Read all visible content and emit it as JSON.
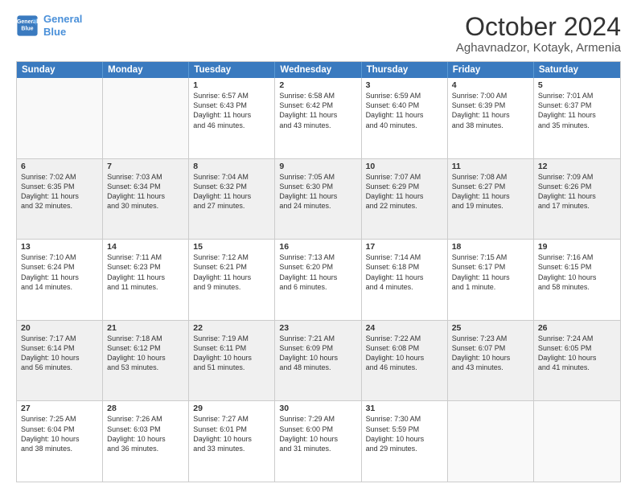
{
  "header": {
    "logo_line1": "General",
    "logo_line2": "Blue",
    "title": "October 2024",
    "subtitle": "Aghavnadzor, Kotayk, Armenia"
  },
  "calendar": {
    "days_of_week": [
      "Sunday",
      "Monday",
      "Tuesday",
      "Wednesday",
      "Thursday",
      "Friday",
      "Saturday"
    ],
    "weeks": [
      [
        {
          "day": "",
          "detail": "",
          "empty": true
        },
        {
          "day": "",
          "detail": "",
          "empty": true
        },
        {
          "day": "1",
          "detail": "Sunrise: 6:57 AM\nSunset: 6:43 PM\nDaylight: 11 hours\nand 46 minutes."
        },
        {
          "day": "2",
          "detail": "Sunrise: 6:58 AM\nSunset: 6:42 PM\nDaylight: 11 hours\nand 43 minutes."
        },
        {
          "day": "3",
          "detail": "Sunrise: 6:59 AM\nSunset: 6:40 PM\nDaylight: 11 hours\nand 40 minutes."
        },
        {
          "day": "4",
          "detail": "Sunrise: 7:00 AM\nSunset: 6:39 PM\nDaylight: 11 hours\nand 38 minutes."
        },
        {
          "day": "5",
          "detail": "Sunrise: 7:01 AM\nSunset: 6:37 PM\nDaylight: 11 hours\nand 35 minutes."
        }
      ],
      [
        {
          "day": "6",
          "detail": "Sunrise: 7:02 AM\nSunset: 6:35 PM\nDaylight: 11 hours\nand 32 minutes."
        },
        {
          "day": "7",
          "detail": "Sunrise: 7:03 AM\nSunset: 6:34 PM\nDaylight: 11 hours\nand 30 minutes."
        },
        {
          "day": "8",
          "detail": "Sunrise: 7:04 AM\nSunset: 6:32 PM\nDaylight: 11 hours\nand 27 minutes."
        },
        {
          "day": "9",
          "detail": "Sunrise: 7:05 AM\nSunset: 6:30 PM\nDaylight: 11 hours\nand 24 minutes."
        },
        {
          "day": "10",
          "detail": "Sunrise: 7:07 AM\nSunset: 6:29 PM\nDaylight: 11 hours\nand 22 minutes."
        },
        {
          "day": "11",
          "detail": "Sunrise: 7:08 AM\nSunset: 6:27 PM\nDaylight: 11 hours\nand 19 minutes."
        },
        {
          "day": "12",
          "detail": "Sunrise: 7:09 AM\nSunset: 6:26 PM\nDaylight: 11 hours\nand 17 minutes."
        }
      ],
      [
        {
          "day": "13",
          "detail": "Sunrise: 7:10 AM\nSunset: 6:24 PM\nDaylight: 11 hours\nand 14 minutes."
        },
        {
          "day": "14",
          "detail": "Sunrise: 7:11 AM\nSunset: 6:23 PM\nDaylight: 11 hours\nand 11 minutes."
        },
        {
          "day": "15",
          "detail": "Sunrise: 7:12 AM\nSunset: 6:21 PM\nDaylight: 11 hours\nand 9 minutes."
        },
        {
          "day": "16",
          "detail": "Sunrise: 7:13 AM\nSunset: 6:20 PM\nDaylight: 11 hours\nand 6 minutes."
        },
        {
          "day": "17",
          "detail": "Sunrise: 7:14 AM\nSunset: 6:18 PM\nDaylight: 11 hours\nand 4 minutes."
        },
        {
          "day": "18",
          "detail": "Sunrise: 7:15 AM\nSunset: 6:17 PM\nDaylight: 11 hours\nand 1 minute."
        },
        {
          "day": "19",
          "detail": "Sunrise: 7:16 AM\nSunset: 6:15 PM\nDaylight: 10 hours\nand 58 minutes."
        }
      ],
      [
        {
          "day": "20",
          "detail": "Sunrise: 7:17 AM\nSunset: 6:14 PM\nDaylight: 10 hours\nand 56 minutes."
        },
        {
          "day": "21",
          "detail": "Sunrise: 7:18 AM\nSunset: 6:12 PM\nDaylight: 10 hours\nand 53 minutes."
        },
        {
          "day": "22",
          "detail": "Sunrise: 7:19 AM\nSunset: 6:11 PM\nDaylight: 10 hours\nand 51 minutes."
        },
        {
          "day": "23",
          "detail": "Sunrise: 7:21 AM\nSunset: 6:09 PM\nDaylight: 10 hours\nand 48 minutes."
        },
        {
          "day": "24",
          "detail": "Sunrise: 7:22 AM\nSunset: 6:08 PM\nDaylight: 10 hours\nand 46 minutes."
        },
        {
          "day": "25",
          "detail": "Sunrise: 7:23 AM\nSunset: 6:07 PM\nDaylight: 10 hours\nand 43 minutes."
        },
        {
          "day": "26",
          "detail": "Sunrise: 7:24 AM\nSunset: 6:05 PM\nDaylight: 10 hours\nand 41 minutes."
        }
      ],
      [
        {
          "day": "27",
          "detail": "Sunrise: 7:25 AM\nSunset: 6:04 PM\nDaylight: 10 hours\nand 38 minutes."
        },
        {
          "day": "28",
          "detail": "Sunrise: 7:26 AM\nSunset: 6:03 PM\nDaylight: 10 hours\nand 36 minutes."
        },
        {
          "day": "29",
          "detail": "Sunrise: 7:27 AM\nSunset: 6:01 PM\nDaylight: 10 hours\nand 33 minutes."
        },
        {
          "day": "30",
          "detail": "Sunrise: 7:29 AM\nSunset: 6:00 PM\nDaylight: 10 hours\nand 31 minutes."
        },
        {
          "day": "31",
          "detail": "Sunrise: 7:30 AM\nSunset: 5:59 PM\nDaylight: 10 hours\nand 29 minutes."
        },
        {
          "day": "",
          "detail": "",
          "empty": true
        },
        {
          "day": "",
          "detail": "",
          "empty": true
        }
      ]
    ]
  }
}
